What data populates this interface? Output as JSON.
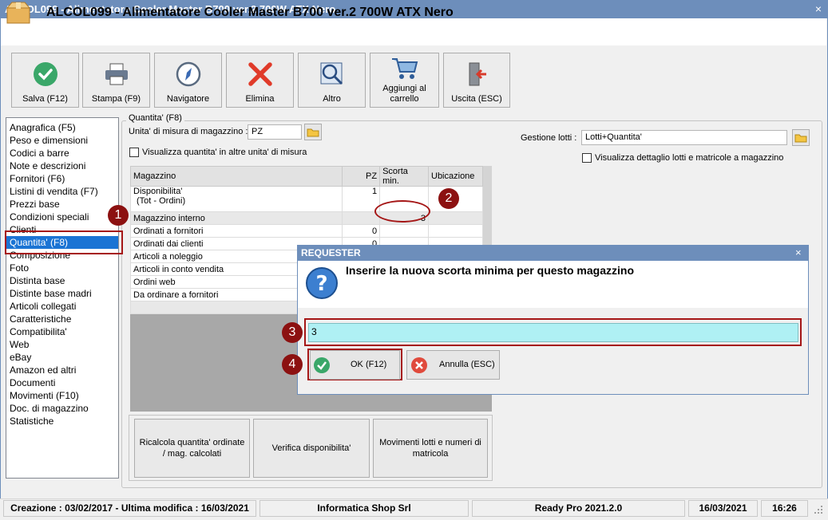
{
  "window": {
    "title": "ALCOL099 - Alimentatore Cooler Master B700 ver.2 700W ATX Nero",
    "close_glyph": "×"
  },
  "header": {
    "product_title": "ALCOL099 - Alimentatore Cooler Master B700 ver.2 700W ATX Nero"
  },
  "toolbar": {
    "save": "Salva (F12)",
    "print": "Stampa (F9)",
    "navigator": "Navigatore",
    "delete": "Elimina",
    "more": "Altro",
    "add_cart_line1": "Aggiungi al",
    "add_cart_line2": "carrello",
    "exit": "Uscita (ESC)"
  },
  "nav": {
    "items": [
      "Anagrafica (F5)",
      "Peso e dimensioni",
      "Codici a barre",
      "Note e descrizioni",
      "Fornitori (F6)",
      "Listini di vendita (F7)",
      "Prezzi base",
      "Condizioni speciali",
      "Clienti",
      "Quantita' (F8)",
      "Composizione",
      "Foto",
      "Distinta base",
      "Distinte base madri",
      "Articoli collegati",
      "Caratteristiche",
      "Compatibilita'",
      "Web",
      "eBay",
      "Amazon ed altri",
      "Documenti",
      "Movimenti (F10)",
      "Doc. di magazzino",
      "Statistiche"
    ]
  },
  "quantity": {
    "legend": "Quantita' (F8)",
    "unit_label": "Unita' di misura di magazzino :",
    "unit_value": "PZ",
    "show_other_units": "Visualizza quantita' in altre unita' di misura",
    "lots_label": "Gestione lotti :",
    "lots_value": "Lotti+Quantita'",
    "show_lot_detail": "Visualizza dettaglio lotti e matricole a magazzino"
  },
  "grid": {
    "headers": [
      "Magazzino",
      "PZ",
      "Scorta min.",
      "Ubicazione"
    ],
    "rows": [
      {
        "name": "Disponibilita'",
        "name2": "(Tot - Ordini)",
        "pz": "1",
        "scorta": ""
      },
      {
        "name": "Magazzino interno",
        "pz": "",
        "scorta": "3"
      },
      {
        "name": "Ordinati a fornitori",
        "pz": "0",
        "scorta": ""
      },
      {
        "name": "Ordinati dai clienti",
        "pz": "0",
        "scorta": ""
      },
      {
        "name": "Articoli a noleggio",
        "pz": "",
        "scorta": ""
      },
      {
        "name": "Articoli in conto vendita",
        "pz": "",
        "scorta": ""
      },
      {
        "name": "Ordini web",
        "pz": "",
        "scorta": ""
      },
      {
        "name": "Da ordinare a fornitori",
        "pz": "",
        "scorta": ""
      }
    ]
  },
  "bottom_buttons": {
    "recalc": "Ricalcola quantita' ordinate / mag. calcolati",
    "verify": "Verifica disponibilita'",
    "lot_moves": "Movimenti lotti e numeri di matricola"
  },
  "dialog": {
    "title": "REQUESTER",
    "close_glyph": "×",
    "message": "Inserire la nuova scorta minima per questo magazzino",
    "input_value": "3",
    "ok": "OK (F12)",
    "cancel": "Annulla (ESC)"
  },
  "callouts": [
    "1",
    "2",
    "3",
    "4"
  ],
  "status": {
    "dates": "Creazione : 03/02/2017 - Ultima modifica : 16/03/2021",
    "company": "Informatica Shop Srl",
    "version": "Ready Pro 2021.2.0",
    "date": "16/03/2021",
    "time": "16:26"
  },
  "colors": {
    "title_bar": "#6d8ebb",
    "selection": "#1b74d4",
    "callout": "#8c1111",
    "input_bg": "#aff0f4"
  }
}
